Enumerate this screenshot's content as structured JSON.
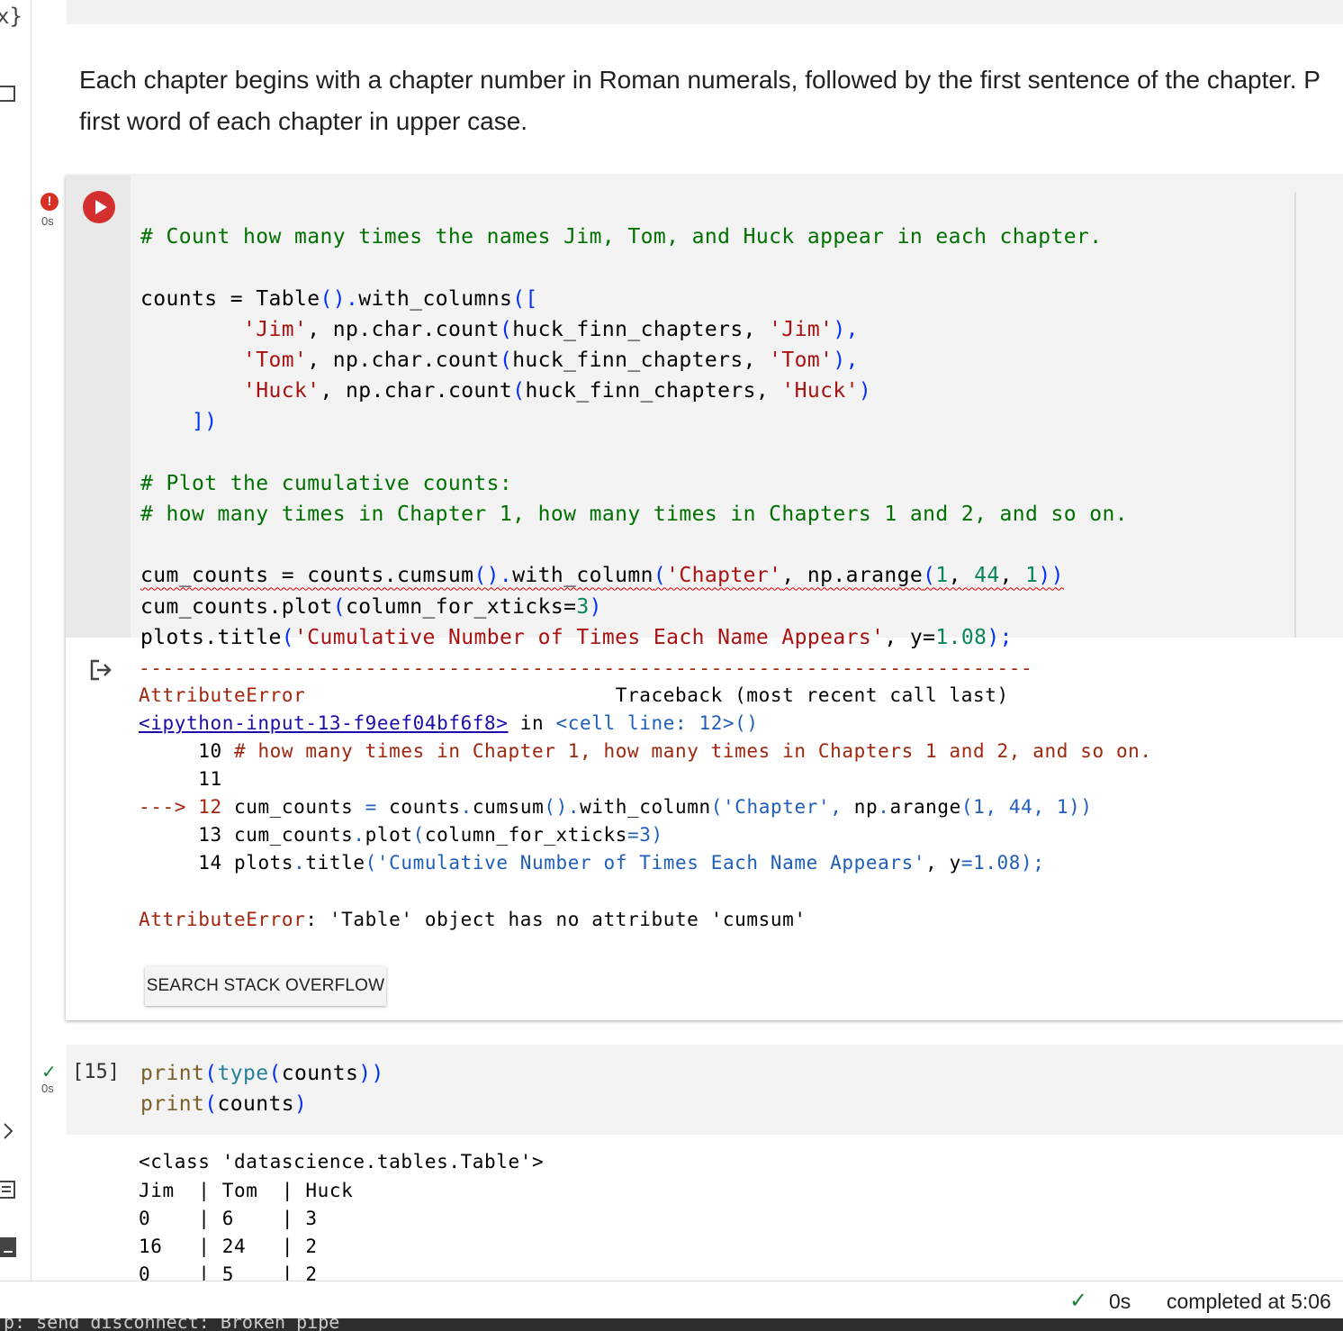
{
  "sidebar": {
    "top_icon_text": "x}"
  },
  "markdown": {
    "line1": "Each chapter begins with a chapter number in Roman numerals, followed by the first sentence of the chapter. P",
    "line2": "first word of each chapter in upper case."
  },
  "cell1": {
    "status_badge": "!",
    "exec_time": "0s",
    "code": {
      "l1": "# Count how many times the names Jim, Tom, and Huck appear in each chapter.",
      "l3a": "counts = Table",
      "l3b": "().",
      "l3c": "with_columns",
      "l3d": "([",
      "l4a": "        'Jim'",
      "l4b": ", np.char.count",
      "l4c": "(",
      "l4d": "huck_finn_chapters, ",
      "l4e": "'Jim'",
      "l4f": "),",
      "l5a": "        'Tom'",
      "l5b": ", np.char.count",
      "l5c": "(",
      "l5d": "huck_finn_chapters, ",
      "l5e": "'Tom'",
      "l5f": "),",
      "l6a": "        'Huck'",
      "l6b": ", np.char.count",
      "l6c": "(",
      "l6d": "huck_finn_chapters, ",
      "l6e": "'Huck'",
      "l6f": ")",
      "l7": "    ])",
      "l9": "# Plot the cumulative counts:",
      "l10": "# how many times in Chapter 1, how many times in Chapters 1 and 2, and so on.",
      "l12a": "cum_counts = counts.cumsum",
      "l12b": "().",
      "l12c": "with_column",
      "l12d": "(",
      "l12e": "'Chapter'",
      "l12f": ", np.arange",
      "l12g": "(",
      "l12h": "1",
      "l12i": ", ",
      "l12j": "44",
      "l12k": ", ",
      "l12l": "1",
      "l12m": "))",
      "l13a": "cum_counts.plot",
      "l13b": "(",
      "l13c": "column_for_xticks=",
      "l13d": "3",
      "l13e": ")",
      "l14a": "plots.title",
      "l14b": "(",
      "l14c": "'Cumulative Number of Times Each Name Appears'",
      "l14d": ", y=",
      "l14e": "1.08",
      "l14f": ");"
    },
    "output": {
      "dashes": "---------------------------------------------------------------------------",
      "err_name": "AttributeError",
      "traceback": "Traceback (most recent call last)",
      "link": "<ipython-input-13-f9eef04bf6f8>",
      "in": " in ",
      "cell_line": "<cell line: 12>()",
      "t10_num": "     10 ",
      "t10": "# how many times in Chapter 1, how many times in Chapters 1 and 2, and so on.",
      "t11_num": "     11",
      "t12_arrow": "---> 12 ",
      "t12a": "cum_counts ",
      "t12b": "= ",
      "t12c": "counts",
      "t12d": ".",
      "t12e": "cumsum",
      "t12f": "().",
      "t12g": "with_column",
      "t12h": "(",
      "t12i": "'Chapter'",
      "t12j": ", ",
      "t12k": "np",
      "t12l": ".",
      "t12m": "arange",
      "t12n": "(1, 44, 1))",
      "t13_num": "     13 ",
      "t13a": "cum_counts",
      "t13b": ".",
      "t13c": "plot",
      "t13d": "(",
      "t13e": "column_for_xticks",
      "t13f": "=3)",
      "t14_num": "     14 ",
      "t14a": "plots",
      "t14b": ".",
      "t14c": "title",
      "t14d": "(",
      "t14e": "'Cumulative Number of Times Each Name Appears'",
      "t14f": ", ",
      "t14g": "y",
      "t14h": "=1.08);",
      "final_name": "AttributeError",
      "final_msg": ": 'Table' object has no attribute 'cumsum'",
      "so_button": "SEARCH STACK OVERFLOW"
    }
  },
  "cell2": {
    "exec_count": "[15]",
    "exec_time": "0s",
    "code": {
      "l1a": "print",
      "l1b": "(",
      "l1c": "type",
      "l1d": "(",
      "l1e": "counts",
      "l1f": "))",
      "l2a": "print",
      "l2b": "(",
      "l2c": "counts",
      "l2d": ")"
    },
    "output": {
      "class_line": "<class 'datascience.tables.Table'>",
      "table_header": "Jim  | Tom  | Huck",
      "rows": [
        "0    | 6    | 3",
        "16   | 24   | 2",
        "0    | 5    | 2"
      ]
    }
  },
  "status": {
    "time": "0s",
    "completed": "completed at 5:06"
  },
  "log": {
    "text": "p: send disconnect: Broken pipe"
  }
}
